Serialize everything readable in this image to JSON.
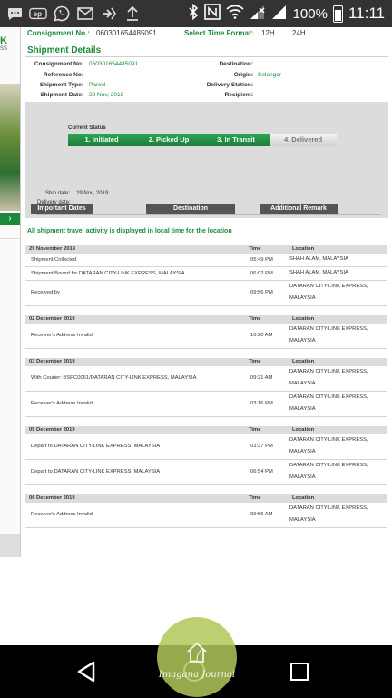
{
  "status_bar": {
    "left_icons": [
      "chat-bubble-icon",
      "ep-icon",
      "whatsapp-icon",
      "gmail-icon",
      "navigation-icon",
      "upload-icon"
    ],
    "right_icons": [
      "bluetooth-icon",
      "nfc-icon",
      "wifi-icon",
      "signal-icon",
      "signal-icon"
    ],
    "battery": "100%",
    "time": "11:11"
  },
  "left_strip": {
    "brand_letter": "K",
    "brand_small": "SS",
    "arrow": "›"
  },
  "top_bar": {
    "consignment_label": "Consignment No.:",
    "consignment_value": "060301654485091",
    "time_format_label": "Select Time Format:",
    "options": [
      "12H",
      "24H"
    ]
  },
  "shipment_details": {
    "title": "Shipment Details",
    "left_fields": [
      {
        "label": "Consignment No:",
        "value": "060301654485091"
      },
      {
        "label": "Reference No:",
        "value": ""
      },
      {
        "label": "Shipment Type:",
        "value": "Parcel"
      },
      {
        "label": "Shipment Date:",
        "value": "29 Nov, 2019"
      }
    ],
    "right_fields": [
      {
        "label": "Destination:",
        "value": ""
      },
      {
        "label": "Origin:",
        "value": "Selangor"
      },
      {
        "label": "Delivery Station:",
        "value": ""
      },
      {
        "label": "Recipient:",
        "value": ""
      }
    ]
  },
  "current_status": {
    "label": "Current Status",
    "steps": [
      {
        "label": "1. Initiated",
        "done": true
      },
      {
        "label": "2. Picked Up",
        "done": true
      },
      {
        "label": "3. In Transit",
        "done": true
      },
      {
        "label": "4. Delivered",
        "done": false
      }
    ]
  },
  "info_headers": [
    "Important Dates",
    "Destination",
    "Additional Remark"
  ],
  "important_dates": [
    {
      "label": "Ship date:",
      "value": "29 Nov, 2019"
    },
    {
      "label": "Delivery date:",
      "value": ""
    }
  ],
  "activity": {
    "notice": "All shipment travel activity is displayed in local time for the location",
    "col_time": "Time",
    "col_location": "Location",
    "groups": [
      {
        "date": "29 November 2019",
        "rows": [
          {
            "desc": "Shipment Collected",
            "time": "05:49 PM",
            "location": "SHAH ALAM, MALAYSIA"
          },
          {
            "desc": "Shipment Bound for DATARAN CITY-LINK EXPRESS, MALAYSIA",
            "time": "06:02 PM",
            "location": "SHAH ALAM, MALAYSIA"
          },
          {
            "desc": "Received by",
            "time": "09:56 PM",
            "location": "DATARAN CITY-LINK EXPRESS, MALAYSIA"
          }
        ]
      },
      {
        "date": "02 December 2019",
        "rows": [
          {
            "desc": "Receiver's Address Invalid",
            "time": "10:20 AM",
            "location": "DATARAN CITY-LINK EXPRESS, MALAYSIA"
          }
        ]
      },
      {
        "date": "03 December 2019",
        "rows": [
          {
            "desc": "With Courier: BSPC0061/DATARAN CITY-LINK EXPRESS, MALAYSIA",
            "time": "09:21 AM",
            "location": "DATARAN CITY-LINK EXPRESS, MALAYSIA"
          },
          {
            "desc": "Receiver's Address Invalid",
            "time": "03:16 PM",
            "location": "DATARAN CITY-LINK EXPRESS, MALAYSIA"
          }
        ]
      },
      {
        "date": "05 December 2019",
        "rows": [
          {
            "desc": "Depart to DATARAN CITY-LINK EXPRESS, MALAYSIA",
            "time": "03:37 PM",
            "location": "DATARAN CITY-LINK EXPRESS, MALAYSIA"
          },
          {
            "desc": "Depart to DATARAN CITY-LINK EXPRESS, MALAYSIA",
            "time": "06:54 PM",
            "location": "DATARAN CITY-LINK EXPRESS, MALAYSIA"
          }
        ]
      },
      {
        "date": "06 December 2019",
        "rows": [
          {
            "desc": "Receiver's Address Invalid",
            "time": "09:56 AM",
            "location": "DATARAN CITY-LINK EXPRESS, MALAYSIA"
          }
        ]
      }
    ]
  },
  "watermark": {
    "text": "Imagana Journal"
  },
  "nav_bar": {
    "icons": [
      "back-icon",
      "home-icon",
      "recents-icon"
    ]
  },
  "colors": {
    "brand_green": "#1b8a3b",
    "status_bar": "#333333",
    "nav_bar": "#000000"
  }
}
